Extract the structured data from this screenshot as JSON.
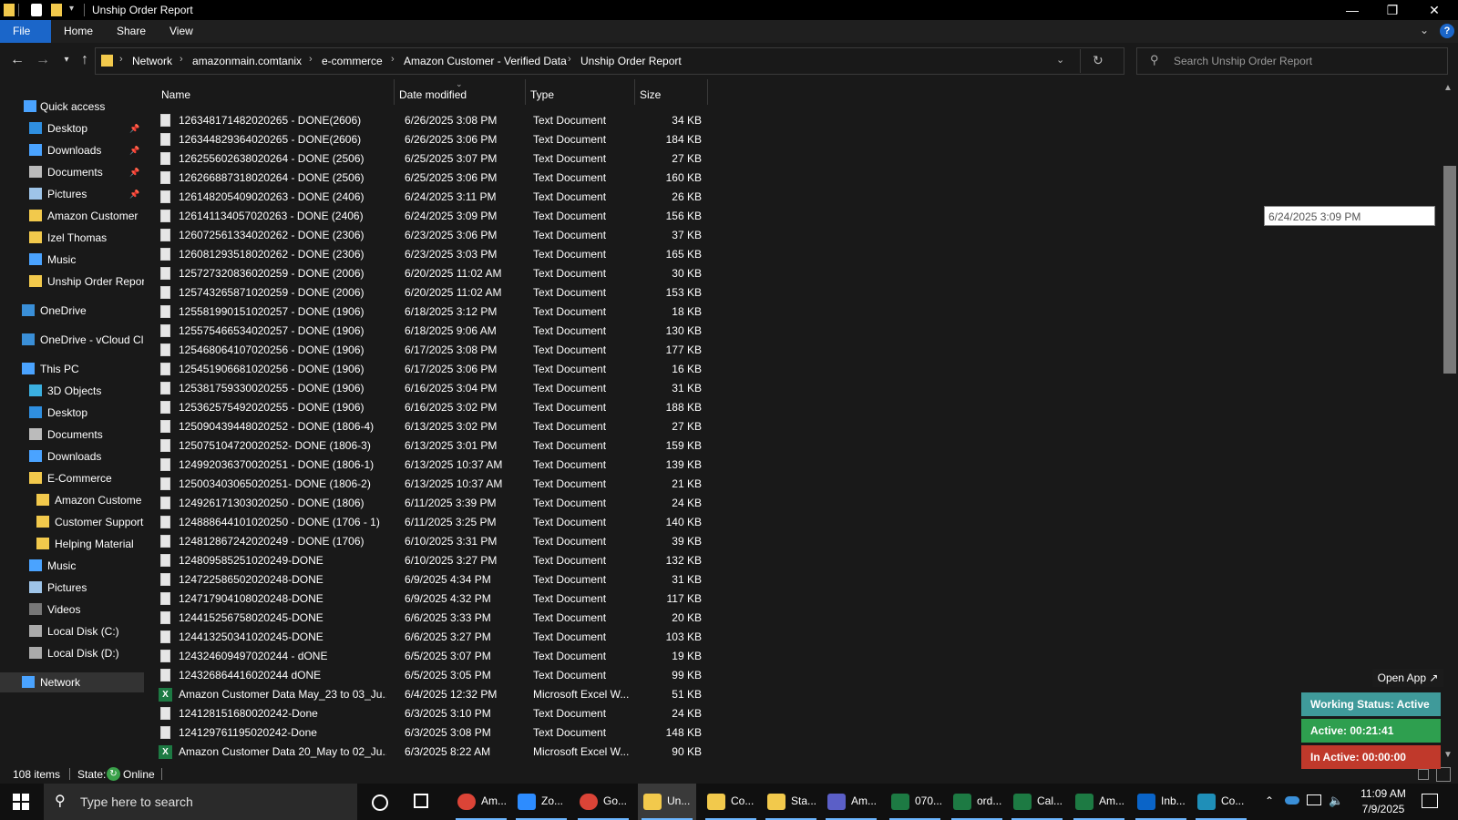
{
  "window": {
    "title": "Unship Order Report"
  },
  "ribbon": {
    "tabs": [
      "File",
      "Home",
      "Share",
      "View"
    ]
  },
  "breadcrumb": [
    "Network",
    "amazonmain.comtanix",
    "e-commerce",
    "Amazon Customer - Verified Data",
    "Unship Order Report"
  ],
  "search": {
    "placeholder": "Search Unship Order Report"
  },
  "sidebar": {
    "items": [
      {
        "label": "Quick access",
        "icon": "star-icon"
      },
      {
        "label": "Desktop",
        "icon": "desktop-icon",
        "pinned": true
      },
      {
        "label": "Downloads",
        "icon": "download-icon",
        "pinned": true
      },
      {
        "label": "Documents",
        "icon": "document-icon",
        "pinned": true
      },
      {
        "label": "Pictures",
        "icon": "pictures-icon",
        "pinned": true
      },
      {
        "label": "Amazon Customer",
        "icon": "folder-icon"
      },
      {
        "label": "Izel Thomas",
        "icon": "folder-icon"
      },
      {
        "label": "Music",
        "icon": "music-icon"
      },
      {
        "label": "Unship Order Repor",
        "icon": "folder-icon"
      },
      {
        "label": "OneDrive",
        "icon": "cloud-icon"
      },
      {
        "label": "OneDrive - vCloud Cl",
        "icon": "cloud-icon"
      },
      {
        "label": "This PC",
        "icon": "computer-icon"
      },
      {
        "label": "3D Objects",
        "icon": "cube-icon"
      },
      {
        "label": "Desktop",
        "icon": "desktop-icon"
      },
      {
        "label": "Documents",
        "icon": "document-icon"
      },
      {
        "label": "Downloads",
        "icon": "download-icon"
      },
      {
        "label": "E-Commerce",
        "icon": "folder-icon"
      },
      {
        "label": "Amazon Custome",
        "icon": "folder-icon"
      },
      {
        "label": "Customer Support",
        "icon": "folder-icon"
      },
      {
        "label": "Helping Material",
        "icon": "folder-icon"
      },
      {
        "label": "Music",
        "icon": "music-icon"
      },
      {
        "label": "Pictures",
        "icon": "pictures-icon"
      },
      {
        "label": "Videos",
        "icon": "video-icon"
      },
      {
        "label": "Local Disk (C:)",
        "icon": "disk-icon"
      },
      {
        "label": "Local Disk (D:)",
        "icon": "disk-icon"
      },
      {
        "label": "Network",
        "icon": "network-icon"
      }
    ]
  },
  "columns": [
    "Name",
    "Date modified",
    "Type",
    "Size"
  ],
  "files": [
    {
      "name": "126348171482020265 - DONE(2606)",
      "date": "6/26/2025 3:08 PM",
      "type": "Text Document",
      "size": "34 KB",
      "kind": "txt"
    },
    {
      "name": "126344829364020265 - DONE(2606)",
      "date": "6/26/2025 3:06 PM",
      "type": "Text Document",
      "size": "184 KB",
      "kind": "txt"
    },
    {
      "name": "126255602638020264 - DONE (2506)",
      "date": "6/25/2025 3:07 PM",
      "type": "Text Document",
      "size": "27 KB",
      "kind": "txt"
    },
    {
      "name": "126266887318020264 - DONE (2506)",
      "date": "6/25/2025 3:06 PM",
      "type": "Text Document",
      "size": "160 KB",
      "kind": "txt"
    },
    {
      "name": "126148205409020263 - DONE (2406)",
      "date": "6/24/2025 3:11 PM",
      "type": "Text Document",
      "size": "26 KB",
      "kind": "txt"
    },
    {
      "name": "126141134057020263 - DONE (2406)",
      "date": "6/24/2025 3:09 PM",
      "type": "Text Document",
      "size": "156 KB",
      "kind": "txt"
    },
    {
      "name": "126072561334020262 - DONE (2306)",
      "date": "6/23/2025 3:06 PM",
      "type": "Text Document",
      "size": "37 KB",
      "kind": "txt"
    },
    {
      "name": "126081293518020262 - DONE (2306)",
      "date": "6/23/2025 3:03 PM",
      "type": "Text Document",
      "size": "165 KB",
      "kind": "txt"
    },
    {
      "name": "125727320836020259 - DONE (2006)",
      "date": "6/20/2025 11:02 AM",
      "type": "Text Document",
      "size": "30 KB",
      "kind": "txt"
    },
    {
      "name": "125743265871020259 - DONE (2006)",
      "date": "6/20/2025 11:02 AM",
      "type": "Text Document",
      "size": "153 KB",
      "kind": "txt"
    },
    {
      "name": "125581990151020257 - DONE (1906)",
      "date": "6/18/2025 3:12 PM",
      "type": "Text Document",
      "size": "18 KB",
      "kind": "txt"
    },
    {
      "name": "125575466534020257 - DONE (1906)",
      "date": "6/18/2025 9:06 AM",
      "type": "Text Document",
      "size": "130 KB",
      "kind": "txt"
    },
    {
      "name": "125468064107020256 - DONE (1906)",
      "date": "6/17/2025 3:08 PM",
      "type": "Text Document",
      "size": "177 KB",
      "kind": "txt"
    },
    {
      "name": "125451906681020256 - DONE (1906)",
      "date": "6/17/2025 3:06 PM",
      "type": "Text Document",
      "size": "16 KB",
      "kind": "txt"
    },
    {
      "name": "125381759330020255 - DONE (1906)",
      "date": "6/16/2025 3:04 PM",
      "type": "Text Document",
      "size": "31 KB",
      "kind": "txt"
    },
    {
      "name": "125362575492020255 - DONE (1906)",
      "date": "6/16/2025 3:02 PM",
      "type": "Text Document",
      "size": "188 KB",
      "kind": "txt"
    },
    {
      "name": "125090439448020252 - DONE (1806-4)",
      "date": "6/13/2025 3:02 PM",
      "type": "Text Document",
      "size": "27 KB",
      "kind": "txt"
    },
    {
      "name": "125075104720020252- DONE (1806-3)",
      "date": "6/13/2025 3:01 PM",
      "type": "Text Document",
      "size": "159 KB",
      "kind": "txt"
    },
    {
      "name": "124992036370020251 - DONE (1806-1)",
      "date": "6/13/2025 10:37 AM",
      "type": "Text Document",
      "size": "139 KB",
      "kind": "txt"
    },
    {
      "name": "125003403065020251- DONE (1806-2)",
      "date": "6/13/2025 10:37 AM",
      "type": "Text Document",
      "size": "21 KB",
      "kind": "txt"
    },
    {
      "name": "124926171303020250 - DONE (1806)",
      "date": "6/11/2025 3:39 PM",
      "type": "Text Document",
      "size": "24 KB",
      "kind": "txt"
    },
    {
      "name": "124888644101020250 - DONE (1706 - 1)",
      "date": "6/11/2025 3:25 PM",
      "type": "Text Document",
      "size": "140 KB",
      "kind": "txt"
    },
    {
      "name": "124812867242020249 - DONE (1706)",
      "date": "6/10/2025 3:31 PM",
      "type": "Text Document",
      "size": "39 KB",
      "kind": "txt"
    },
    {
      "name": "124809585251020249-DONE",
      "date": "6/10/2025 3:27 PM",
      "type": "Text Document",
      "size": "132 KB",
      "kind": "txt"
    },
    {
      "name": "124722586502020248-DONE",
      "date": "6/9/2025 4:34 PM",
      "type": "Text Document",
      "size": "31 KB",
      "kind": "txt"
    },
    {
      "name": "124717904108020248-DONE",
      "date": "6/9/2025 4:32 PM",
      "type": "Text Document",
      "size": "117 KB",
      "kind": "txt"
    },
    {
      "name": "124415256758020245-DONE",
      "date": "6/6/2025 3:33 PM",
      "type": "Text Document",
      "size": "20 KB",
      "kind": "txt"
    },
    {
      "name": "124413250341020245-DONE",
      "date": "6/6/2025 3:27 PM",
      "type": "Text Document",
      "size": "103 KB",
      "kind": "txt"
    },
    {
      "name": "124324609497020244 - dONE",
      "date": "6/5/2025 3:07 PM",
      "type": "Text Document",
      "size": "19 KB",
      "kind": "txt"
    },
    {
      "name": "124326864416020244 dONE",
      "date": "6/5/2025 3:05 PM",
      "type": "Text Document",
      "size": "99 KB",
      "kind": "txt"
    },
    {
      "name": "Amazon Customer Data May_23 to 03_Ju...",
      "date": "6/4/2025 12:32 PM",
      "type": "Microsoft Excel W...",
      "size": "51 KB",
      "kind": "xls"
    },
    {
      "name": "124128151680020242-Done",
      "date": "6/3/2025 3:10 PM",
      "type": "Text Document",
      "size": "24 KB",
      "kind": "txt"
    },
    {
      "name": "124129761195020242-Done",
      "date": "6/3/2025 3:08 PM",
      "type": "Text Document",
      "size": "148 KB",
      "kind": "txt"
    },
    {
      "name": "Amazon Customer Data 20_May to 02_Ju...",
      "date": "6/3/2025 8:22 AM",
      "type": "Microsoft Excel W...",
      "size": "90 KB",
      "kind": "xls"
    }
  ],
  "tooltip": "6/24/2025 3:09 PM",
  "status": {
    "count": "108 items",
    "state_label": "State:",
    "state_value": "Online"
  },
  "widget": {
    "open_app": "Open App ↗",
    "working_status": "Working Status: Active",
    "active": "Active: 00:21:41",
    "inactive": "In Active: 00:00:00",
    "colors": {
      "working": "#3f9a9a",
      "active": "#2e9f4f",
      "inactive": "#c0392b"
    }
  },
  "taskbar": {
    "search_placeholder": "Type here to search",
    "apps": [
      {
        "label": "Am...",
        "icon": "chrome-icon",
        "color": "#db4437"
      },
      {
        "label": "Zo...",
        "icon": "zoom-icon",
        "color": "#2d8cff"
      },
      {
        "label": "Go...",
        "icon": "chrome-icon",
        "color": "#db4437"
      },
      {
        "label": "Un...",
        "icon": "folder-icon",
        "color": "#f2c94c",
        "active": true
      },
      {
        "label": "Co...",
        "icon": "folder-icon",
        "color": "#f2c94c"
      },
      {
        "label": "Sta...",
        "icon": "folder-icon",
        "color": "#f2c94c"
      },
      {
        "label": "Am...",
        "icon": "teams-icon",
        "color": "#5b5fc7"
      },
      {
        "label": "070...",
        "icon": "excel-icon",
        "color": "#1d7a43"
      },
      {
        "label": "ord...",
        "icon": "excel-icon",
        "color": "#1d7a43"
      },
      {
        "label": "Cal...",
        "icon": "excel-icon",
        "color": "#1d7a43"
      },
      {
        "label": "Am...",
        "icon": "excel-icon",
        "color": "#1d7a43"
      },
      {
        "label": "Inb...",
        "icon": "outlook-icon",
        "color": "#0a64c8"
      },
      {
        "label": "Co...",
        "icon": "edge-icon",
        "color": "#1f8fb8"
      }
    ],
    "time": "11:09 AM",
    "date": "7/9/2025"
  }
}
